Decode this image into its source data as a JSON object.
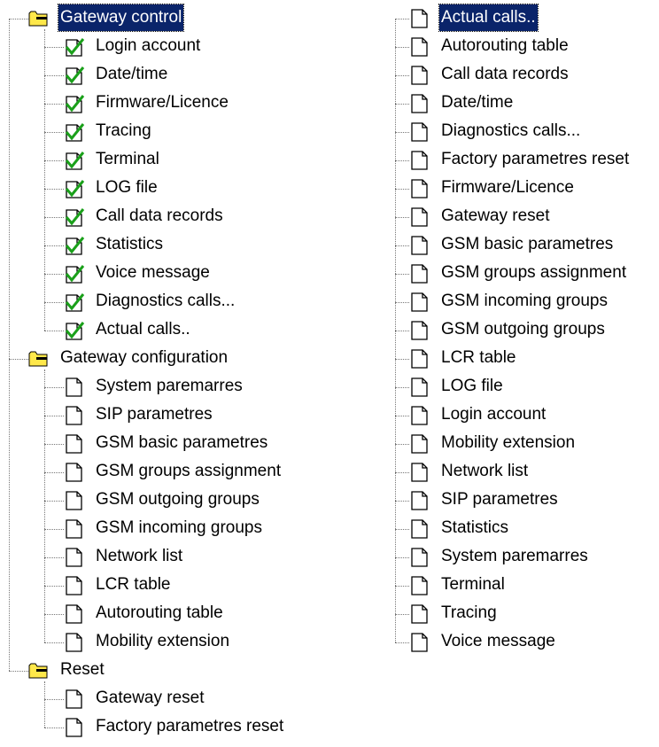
{
  "left_tree": {
    "folders": [
      {
        "label": "Gateway control",
        "selected": true,
        "item_icon": "checked-page-icon",
        "items": [
          "Login account",
          "Date/time",
          "Firmware/Licence",
          "Tracing",
          "Terminal",
          "LOG file",
          "Call data records",
          "Statistics",
          "Voice message",
          "Diagnostics calls...",
          "Actual calls.."
        ]
      },
      {
        "label": "Gateway configuration",
        "selected": false,
        "item_icon": "page-icon",
        "items": [
          "System paremarres",
          "SIP parametres",
          "GSM basic parametres",
          "GSM groups assignment",
          "GSM outgoing groups",
          "GSM incoming groups",
          "Network list",
          "LCR table",
          "Autorouting table",
          "Mobility extension"
        ]
      },
      {
        "label": "Reset",
        "selected": false,
        "item_icon": "page-icon",
        "items": [
          "Gateway reset",
          "Factory parametres reset"
        ]
      }
    ]
  },
  "right_tree": {
    "selected_index": 0,
    "items": [
      "Actual calls..",
      "Autorouting table",
      "Call data records",
      "Date/time",
      "Diagnostics calls...",
      "Factory parametres reset",
      "Firmware/Licence",
      "Gateway reset",
      "GSM basic parametres",
      "GSM groups assignment",
      "GSM incoming groups",
      "GSM outgoing groups",
      "LCR table",
      "LOG file",
      "Login account",
      "Mobility extension",
      "Network list",
      "SIP parametres",
      "Statistics",
      "System paremarres",
      "Terminal",
      "Tracing",
      "Voice message"
    ]
  },
  "colors": {
    "selection": "#0a246a",
    "check": "#1aa01a",
    "folder": "#ffe84a"
  }
}
